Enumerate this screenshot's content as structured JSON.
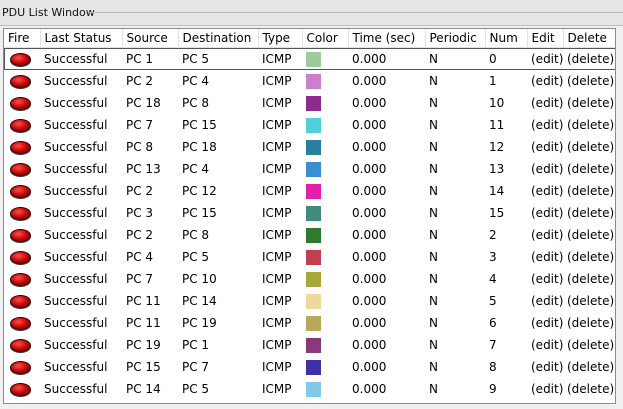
{
  "window": {
    "title": "PDU List Window"
  },
  "columns": {
    "fire": "Fire",
    "last_status": "Last Status",
    "source": "Source",
    "destination": "Destination",
    "type": "Type",
    "color": "Color",
    "time": "Time (sec)",
    "periodic": "Periodic",
    "num": "Num",
    "edit": "Edit",
    "delete": "Delete"
  },
  "rows": [
    {
      "status": "Successful",
      "source": "PC 1",
      "destination": "PC 5",
      "type": "ICMP",
      "color": "#9ecb9a",
      "time": "0.000",
      "periodic": "N",
      "num": "0",
      "edit": "(edit)",
      "delete": "(delete)"
    },
    {
      "status": "Successful",
      "source": "PC 2",
      "destination": "PC 4",
      "type": "ICMP",
      "color": "#cc80cc",
      "time": "0.000",
      "periodic": "N",
      "num": "1",
      "edit": "(edit)",
      "delete": "(delete)"
    },
    {
      "status": "Successful",
      "source": "PC 18",
      "destination": "PC 8",
      "type": "ICMP",
      "color": "#8e2a8e",
      "time": "0.000",
      "periodic": "N",
      "num": "10",
      "edit": "(edit)",
      "delete": "(delete)"
    },
    {
      "status": "Successful",
      "source": "PC 7",
      "destination": "PC 15",
      "type": "ICMP",
      "color": "#4fd1d9",
      "time": "0.000",
      "periodic": "N",
      "num": "11",
      "edit": "(edit)",
      "delete": "(delete)"
    },
    {
      "status": "Successful",
      "source": "PC 8",
      "destination": "PC 18",
      "type": "ICMP",
      "color": "#2a7f9f",
      "time": "0.000",
      "periodic": "N",
      "num": "12",
      "edit": "(edit)",
      "delete": "(delete)"
    },
    {
      "status": "Successful",
      "source": "PC 13",
      "destination": "PC 4",
      "type": "ICMP",
      "color": "#3a8fd0",
      "time": "0.000",
      "periodic": "N",
      "num": "13",
      "edit": "(edit)",
      "delete": "(delete)"
    },
    {
      "status": "Successful",
      "source": "PC 2",
      "destination": "PC 12",
      "type": "ICMP",
      "color": "#e020a8",
      "time": "0.000",
      "periodic": "N",
      "num": "14",
      "edit": "(edit)",
      "delete": "(delete)"
    },
    {
      "status": "Successful",
      "source": "PC 3",
      "destination": "PC 15",
      "type": "ICMP",
      "color": "#3f8c7a",
      "time": "0.000",
      "periodic": "N",
      "num": "15",
      "edit": "(edit)",
      "delete": "(delete)"
    },
    {
      "status": "Successful",
      "source": "PC 2",
      "destination": "PC 8",
      "type": "ICMP",
      "color": "#2e7a2e",
      "time": "0.000",
      "periodic": "N",
      "num": "2",
      "edit": "(edit)",
      "delete": "(delete)"
    },
    {
      "status": "Successful",
      "source": "PC 4",
      "destination": "PC 5",
      "type": "ICMP",
      "color": "#c0404e",
      "time": "0.000",
      "periodic": "N",
      "num": "3",
      "edit": "(edit)",
      "delete": "(delete)"
    },
    {
      "status": "Successful",
      "source": "PC 7",
      "destination": "PC 10",
      "type": "ICMP",
      "color": "#a8a83a",
      "time": "0.000",
      "periodic": "N",
      "num": "4",
      "edit": "(edit)",
      "delete": "(delete)"
    },
    {
      "status": "Successful",
      "source": "PC 11",
      "destination": "PC 14",
      "type": "ICMP",
      "color": "#eed89a",
      "time": "0.000",
      "periodic": "N",
      "num": "5",
      "edit": "(edit)",
      "delete": "(delete)"
    },
    {
      "status": "Successful",
      "source": "PC 11",
      "destination": "PC 19",
      "type": "ICMP",
      "color": "#b8a85a",
      "time": "0.000",
      "periodic": "N",
      "num": "6",
      "edit": "(edit)",
      "delete": "(delete)"
    },
    {
      "status": "Successful",
      "source": "PC 19",
      "destination": "PC 1",
      "type": "ICMP",
      "color": "#8a3a7a",
      "time": "0.000",
      "periodic": "N",
      "num": "7",
      "edit": "(edit)",
      "delete": "(delete)"
    },
    {
      "status": "Successful",
      "source": "PC 15",
      "destination": "PC 7",
      "type": "ICMP",
      "color": "#4030a8",
      "time": "0.000",
      "periodic": "N",
      "num": "8",
      "edit": "(edit)",
      "delete": "(delete)"
    },
    {
      "status": "Successful",
      "source": "PC 14",
      "destination": "PC 5",
      "type": "ICMP",
      "color": "#80cce8",
      "time": "0.000",
      "periodic": "N",
      "num": "9",
      "edit": "(edit)",
      "delete": "(delete)"
    }
  ],
  "icons": {
    "fire": "fire-button-icon"
  }
}
